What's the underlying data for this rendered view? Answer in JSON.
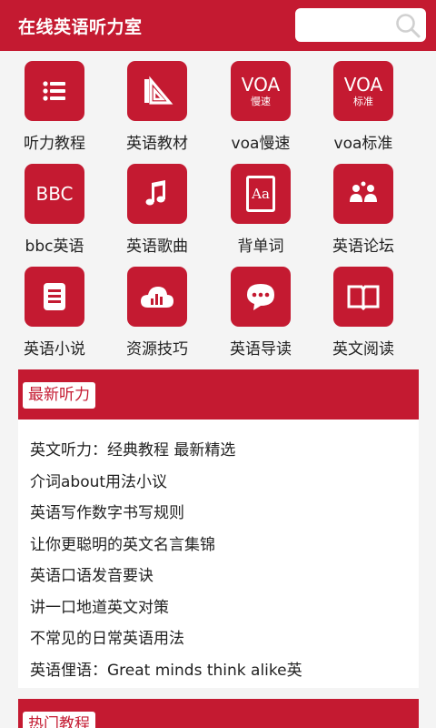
{
  "header": {
    "title": "在线英语听力室",
    "search_placeholder": ""
  },
  "grid": [
    {
      "label": "听力教程",
      "icon": "list-icon"
    },
    {
      "label": "英语教材",
      "icon": "triangle-ruler-icon"
    },
    {
      "label": "voa慢速",
      "icon": "voa-slow-icon",
      "glyph": "VOA",
      "glyph_sub": "慢速"
    },
    {
      "label": "voa标准",
      "icon": "voa-standard-icon",
      "glyph": "VOA",
      "glyph_sub": "标准"
    },
    {
      "label": "bbc英语",
      "icon": "bbc-icon",
      "glyph": "BBC"
    },
    {
      "label": "英语歌曲",
      "icon": "music-note-icon"
    },
    {
      "label": "背单词",
      "icon": "dictionary-icon",
      "glyph": "Aa"
    },
    {
      "label": "英语论坛",
      "icon": "community-icon"
    },
    {
      "label": "英语小说",
      "icon": "document-icon"
    },
    {
      "label": "资源技巧",
      "icon": "cloud-chart-icon"
    },
    {
      "label": "英语导读",
      "icon": "chat-bubble-icon"
    },
    {
      "label": "英文阅读",
      "icon": "open-book-icon"
    }
  ],
  "latest": {
    "title": "最新听力",
    "items": [
      "英文听力：经典教程 最新精选",
      "介词about用法小议",
      "英语写作数字书写规则",
      "让你更聪明的英文名言集锦",
      "英语口语发音要诀",
      "讲一口地道英文对策",
      "不常见的日常英语用法",
      "英语俚语：Great minds think alike英"
    ]
  },
  "popular": {
    "title": "热门教程"
  },
  "colors": {
    "brand": "#c41a31",
    "background": "#f4f4f4"
  }
}
